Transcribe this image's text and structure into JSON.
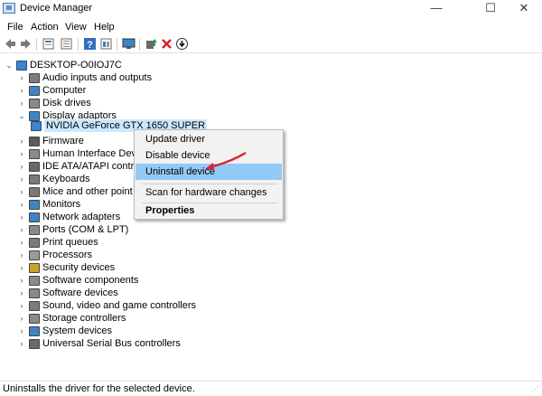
{
  "window": {
    "title": "Device Manager",
    "minimize_glyph": "—",
    "maximize_glyph": "☐",
    "close_glyph": "✕"
  },
  "menu": [
    "File",
    "Action",
    "View",
    "Help"
  ],
  "toolbar": {
    "icons": [
      "back-arrow-icon",
      "forward-arrow-icon",
      "properties-sheet-icon",
      "device-list-icon",
      "help-icon",
      "view-list-icon",
      "monitor-scan-icon",
      "update-driver-icon",
      "uninstall-x-icon",
      "download-circle-icon"
    ]
  },
  "tree": {
    "root": "DESKTOP-O0IOJ7C",
    "items": [
      {
        "label": "Audio inputs and outputs",
        "color": "#7c7c7c"
      },
      {
        "label": "Computer",
        "color": "#3d85c6"
      },
      {
        "label": "Disk drives",
        "color": "#8a8a8a"
      },
      {
        "label": "Display adaptors",
        "color": "#3d85c6",
        "expanded": true
      },
      {
        "label": "Firmware",
        "color": "#5a5a5a"
      },
      {
        "label": "Human Interface Dev",
        "color": "#8a8a8a"
      },
      {
        "label": "IDE ATA/ATAPI contro",
        "color": "#6a6a6a"
      },
      {
        "label": "Keyboards",
        "color": "#7a7a7a"
      },
      {
        "label": "Mice and other point",
        "color": "#7a7a7a"
      },
      {
        "label": "Monitors",
        "color": "#3d85c6"
      },
      {
        "label": "Network adapters",
        "color": "#3d85c6"
      },
      {
        "label": "Ports (COM & LPT)",
        "color": "#8a8a8a"
      },
      {
        "label": "Print queues",
        "color": "#7a7a7a"
      },
      {
        "label": "Processors",
        "color": "#9a9a9a"
      },
      {
        "label": "Security devices",
        "color": "#c9a227"
      },
      {
        "label": "Software components",
        "color": "#8a8a8a"
      },
      {
        "label": "Software devices",
        "color": "#8a8a8a"
      },
      {
        "label": "Sound, video and game controllers",
        "color": "#7c7c7c"
      },
      {
        "label": "Storage controllers",
        "color": "#8a8a8a"
      },
      {
        "label": "System devices",
        "color": "#3d85c6"
      },
      {
        "label": "Universal Serial Bus controllers",
        "color": "#6a6a6a"
      }
    ],
    "child": {
      "label": "NVIDIA GeForce GTX 1650 SUPER",
      "color": "#3d85c6"
    }
  },
  "context_menu": {
    "items": [
      "Update driver",
      "Disable device",
      "Uninstall device",
      "Scan for hardware changes",
      "Properties"
    ],
    "highlighted": "Uninstall device"
  },
  "status": "Uninstalls the driver for the selected device.",
  "colors": {
    "highlight": "#91c9f7",
    "selection": "#cce8ff",
    "arrow": "#d9202f"
  }
}
